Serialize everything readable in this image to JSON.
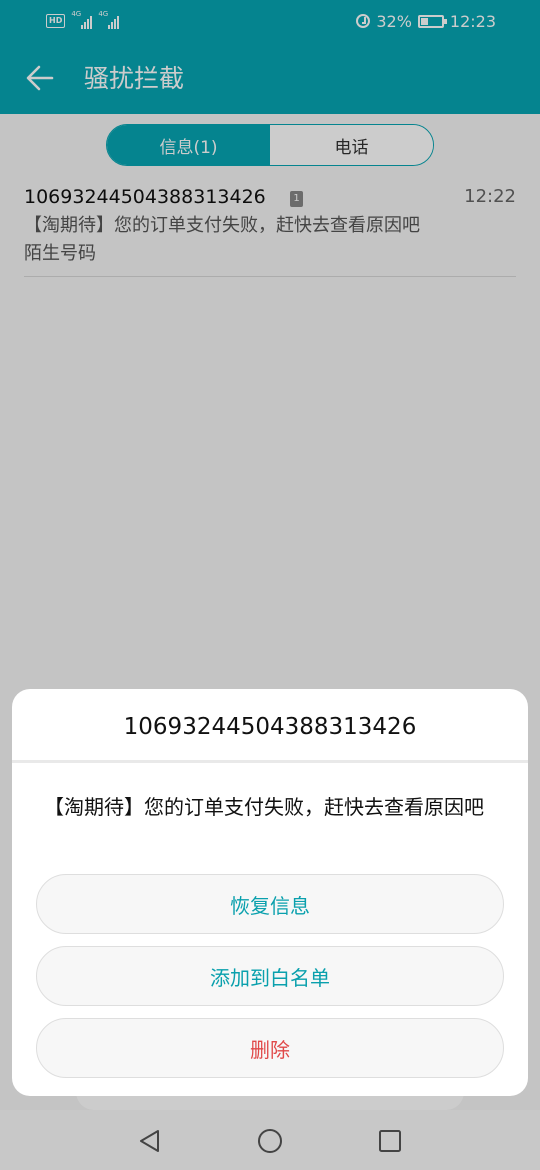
{
  "status_bar": {
    "hd_badge": "HD",
    "network_1": "4G",
    "network_2": "4G",
    "battery_percent": "32%",
    "battery_level": 0.32,
    "time": "12:23"
  },
  "app_bar": {
    "title": "骚扰拦截"
  },
  "tabs": [
    {
      "label": "信息(1)",
      "active": true
    },
    {
      "label": "电话",
      "active": false
    }
  ],
  "messages": [
    {
      "sender": "10693244504388313426",
      "sim": "1",
      "time": "12:22",
      "preview": "【淘期待】您的订单支付失败，赶快去查看原因吧",
      "tag": "陌生号码"
    }
  ],
  "dialog": {
    "title": "10693244504388313426",
    "body": "【淘期待】您的订单支付失败，赶快去查看原因吧",
    "actions": {
      "restore": "恢复信息",
      "whitelist": "添加到白名单",
      "delete": "删除"
    }
  },
  "colors": {
    "accent": "#07a6b3",
    "danger": "#e04848"
  },
  "icons": {
    "back": "arrow-left-icon",
    "alarm": "alarm-icon",
    "battery": "battery-icon",
    "nav_back": "triangle-back-icon",
    "nav_home": "circle-home-icon",
    "nav_recent": "square-recent-icon"
  }
}
